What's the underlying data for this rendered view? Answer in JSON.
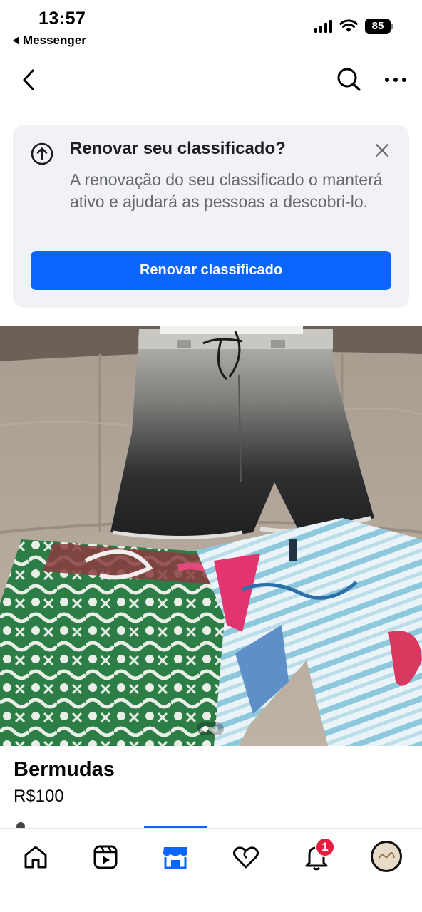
{
  "status_bar": {
    "time": "13:57",
    "back_app": "Messenger",
    "battery": "85"
  },
  "nav": {
    "back_icon": "chevron-left-icon",
    "search_icon": "search-icon",
    "more_icon": "more-icon"
  },
  "renew_card": {
    "title": "Renovar seu classificado?",
    "body": "A renovação do seu classificado o manterá ativo e ajudará as pessoas a descobri-lo.",
    "button_label": "Renovar classificado"
  },
  "carousel": {
    "current_index": 1,
    "total": 2
  },
  "listing": {
    "title": "Bermudas",
    "price": "R$100"
  },
  "tab_bar": {
    "items": [
      {
        "icon": "home-icon"
      },
      {
        "icon": "reels-icon"
      },
      {
        "icon": "marketplace-icon",
        "active": true
      },
      {
        "icon": "dating-icon"
      },
      {
        "icon": "notifications-icon"
      },
      {
        "icon": "profile-avatar"
      }
    ],
    "notifications_badge": "1"
  },
  "colors": {
    "accent": "#0866ff",
    "badge": "#e41e3f",
    "card_bg": "#f0f2f5",
    "muted_text": "#65676b"
  }
}
